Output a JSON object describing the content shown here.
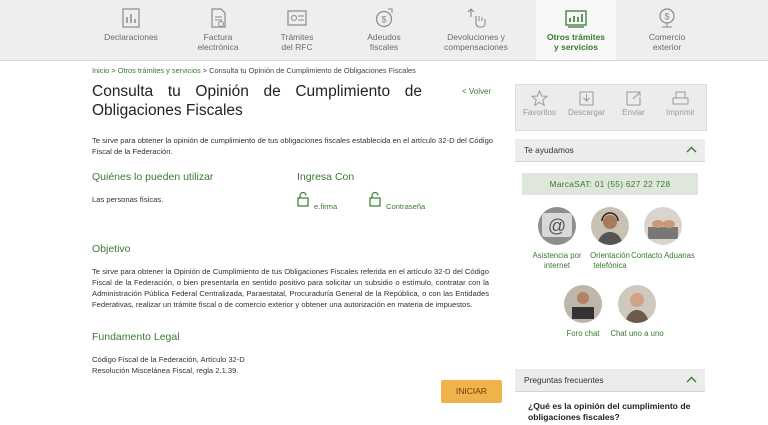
{
  "nav": {
    "items": [
      {
        "label": "Declaraciones",
        "icon": "declaraciones-icon"
      },
      {
        "label": "Factura electrónica",
        "icon": "factura-icon"
      },
      {
        "label": "Trámites del RFC",
        "icon": "rfc-icon"
      },
      {
        "label": "Adeudos fiscales",
        "icon": "adeudos-icon"
      },
      {
        "label": "Devoluciones y compensaciones",
        "icon": "devoluciones-icon"
      },
      {
        "label": "Otros trámites y servicios",
        "icon": "otros-tramites-icon",
        "active": true
      },
      {
        "label": "Comercio exterior",
        "icon": "comercio-exterior-icon"
      }
    ]
  },
  "breadcrumb": {
    "inicio": "Inicio",
    "sep": ">",
    "otros": "Otros trámites y servicios",
    "current": "Consulta tu Opinión de Cumplimiento de Obligaciones Fiscales"
  },
  "page": {
    "title_line1": "Consulta tu Opinión de Cumplimiento de",
    "title_line2": "Obligaciones Fiscales",
    "volver": "< Volver",
    "intro": "Te sirve para obtener la opinión de cumplimiento de tus obligaciones fiscales establecida en el artículo 32-D del Código Fiscal de la Federación.",
    "quienes_heading": "Quiénes lo pueden utilizar",
    "quienes_text": "Las personas físicas.",
    "ingresa_heading": "Ingresa Con",
    "login_efirma": "e.firma",
    "login_contrasena": "Contraseña",
    "objetivo_heading": "Objetivo",
    "objetivo_text": "Te sirve para obtener la Opinión de Cumplimiento de tus Obligaciones Fiscales referida en el artículo 32-D del Código Fiscal de la Federación, o bien presentarla en sentido positivo para solicitar un subsidio o estímulo, contratar con la Administración Pública Federal Centralizada, Paraestatal, Procuraduría General de la República, o con las Entidades Federativas, realizar un trámite fiscal o de comercio exterior y obtener una autorización en materia de impuestos.",
    "fundamento_heading": "Fundamento Legal",
    "fundamento_line1": "Código Fiscal de la Federación, Artículo 32-D",
    "fundamento_line2": "Resolución Miscelánea Fiscal, regla 2.1.39.",
    "iniciar": "INICIAR"
  },
  "sidebar": {
    "toolbar": [
      {
        "label": "Favoritos",
        "icon": "star-icon"
      },
      {
        "label": "Descargar",
        "icon": "download-icon"
      },
      {
        "label": "Enviar",
        "icon": "share-icon"
      },
      {
        "label": "Imprimir",
        "icon": "printer-icon"
      }
    ],
    "te_ayudamos": "Te ayudamos",
    "marcasat": "MarcaSAT: 01 (55) 627 22 728",
    "help": [
      {
        "label": "Asistencia por internet"
      },
      {
        "label": "Orientación telefónica"
      },
      {
        "label": "Contacto Aduanas"
      },
      {
        "label": "Foro chat"
      },
      {
        "label": "Chat uno a uno"
      }
    ],
    "preguntas": "Preguntas frecuentes",
    "faq_question": "¿Qué es la opinión del cumplimiento de obligaciones fiscales?"
  },
  "colors": {
    "accent_green": "#3a7a32",
    "button_orange": "#f0b34c",
    "nav_bg": "#eeeeee",
    "panel_bg": "#ececec"
  }
}
